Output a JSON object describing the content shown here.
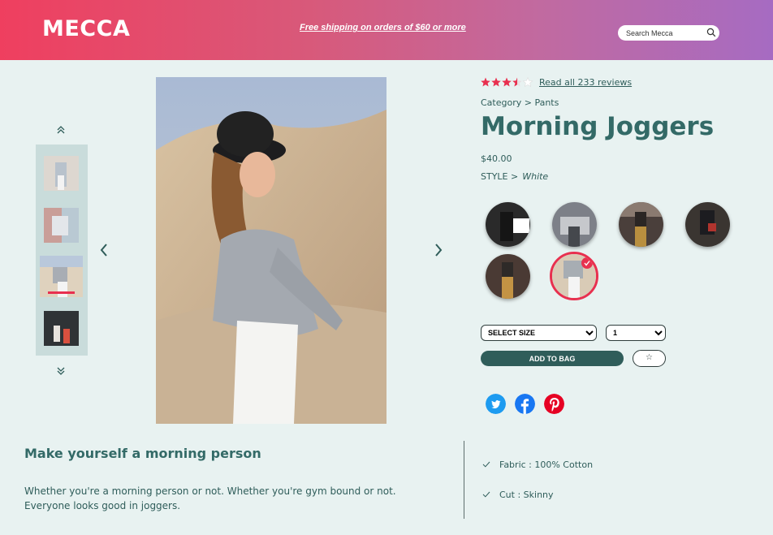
{
  "header": {
    "logo": "MECCA",
    "promo": "Free shipping on orders of $60 or more",
    "search_placeholder": "Search Mecca"
  },
  "product": {
    "rating": 3.5,
    "rating_max": 5,
    "reviews_link": "Read all 233 reviews",
    "breadcrumb": "Category > Pants",
    "title": "Morning Joggers",
    "price": "$40.00",
    "style_label": "STYLE >",
    "style_value": "White",
    "size_select": "SELECT SIZE",
    "qty_select": "1",
    "add_to_bag": "ADD TO BAG"
  },
  "description": {
    "heading": "Make yourself a morning person",
    "body_line1": "Whether you're a morning person or not. Whether you're gym bound or not.",
    "body_line2": "Everyone looks good in joggers."
  },
  "features": [
    "Fabric : 100% Cotton",
    "Cut : Skinny"
  ],
  "colors": {
    "accent": "#e8304f",
    "brand_teal": "#2f5d5a",
    "background": "#e8f2f1"
  }
}
